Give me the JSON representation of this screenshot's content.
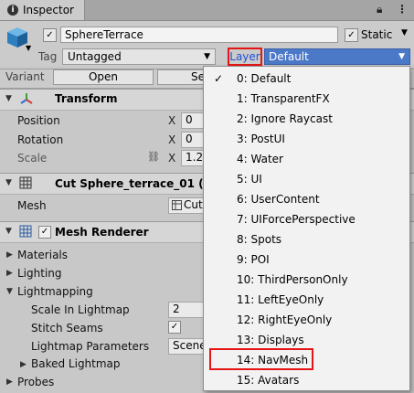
{
  "tab": {
    "label": "Inspector",
    "icon": "info-icon"
  },
  "header": {
    "object_name": "SphereTerrace",
    "active_check": "✓",
    "static_label": "Static",
    "static_check": "✓",
    "tag_label": "Tag",
    "tag_value": "Untagged",
    "layer_label": "Layer",
    "layer_value": "Default"
  },
  "variant": {
    "label": "Variant",
    "open_label": "Open",
    "select_label": "Se"
  },
  "transform": {
    "title": "Transform",
    "position_label": "Position",
    "position_x": "0",
    "rotation_label": "Rotation",
    "rotation_x": "0",
    "scale_label": "Scale",
    "scale_x": "1.2",
    "axis_x": "X"
  },
  "mesh_filter": {
    "title": "Cut Sphere_terrace_01 (Me",
    "mesh_label": "Mesh",
    "mesh_value": "Cut"
  },
  "mesh_renderer": {
    "title": "Mesh Renderer",
    "enabled_check": "✓",
    "materials_label": "Materials",
    "lighting_label": "Lighting",
    "lightmapping_label": "Lightmapping",
    "scale_in_lightmap_label": "Scale In Lightmap",
    "scale_in_lightmap_value": "2",
    "stitch_seams_label": "Stitch Seams",
    "stitch_seams_check": "✓",
    "lightmap_params_label": "Lightmap Parameters",
    "lightmap_params_value": "Scene",
    "baked_lightmap_label": "Baked Lightmap",
    "probes_label": "Probes"
  },
  "layer_menu": {
    "selected_check": "✓",
    "items": [
      "0: Default",
      "1: TransparentFX",
      "2: Ignore Raycast",
      "3: PostUI",
      "4: Water",
      "5: UI",
      "6: UserContent",
      "7: UIForcePerspective",
      "8: Spots",
      "9: POI",
      "10: ThirdPersonOnly",
      "11: LeftEyeOnly",
      "12: RightEyeOnly",
      "13: Displays",
      "14: NavMesh",
      "15: Avatars"
    ]
  },
  "colors": {
    "highlight": "#e51515",
    "layer_blue": "#2050d8",
    "layer_dropdown_bg": "#4c78c8"
  }
}
